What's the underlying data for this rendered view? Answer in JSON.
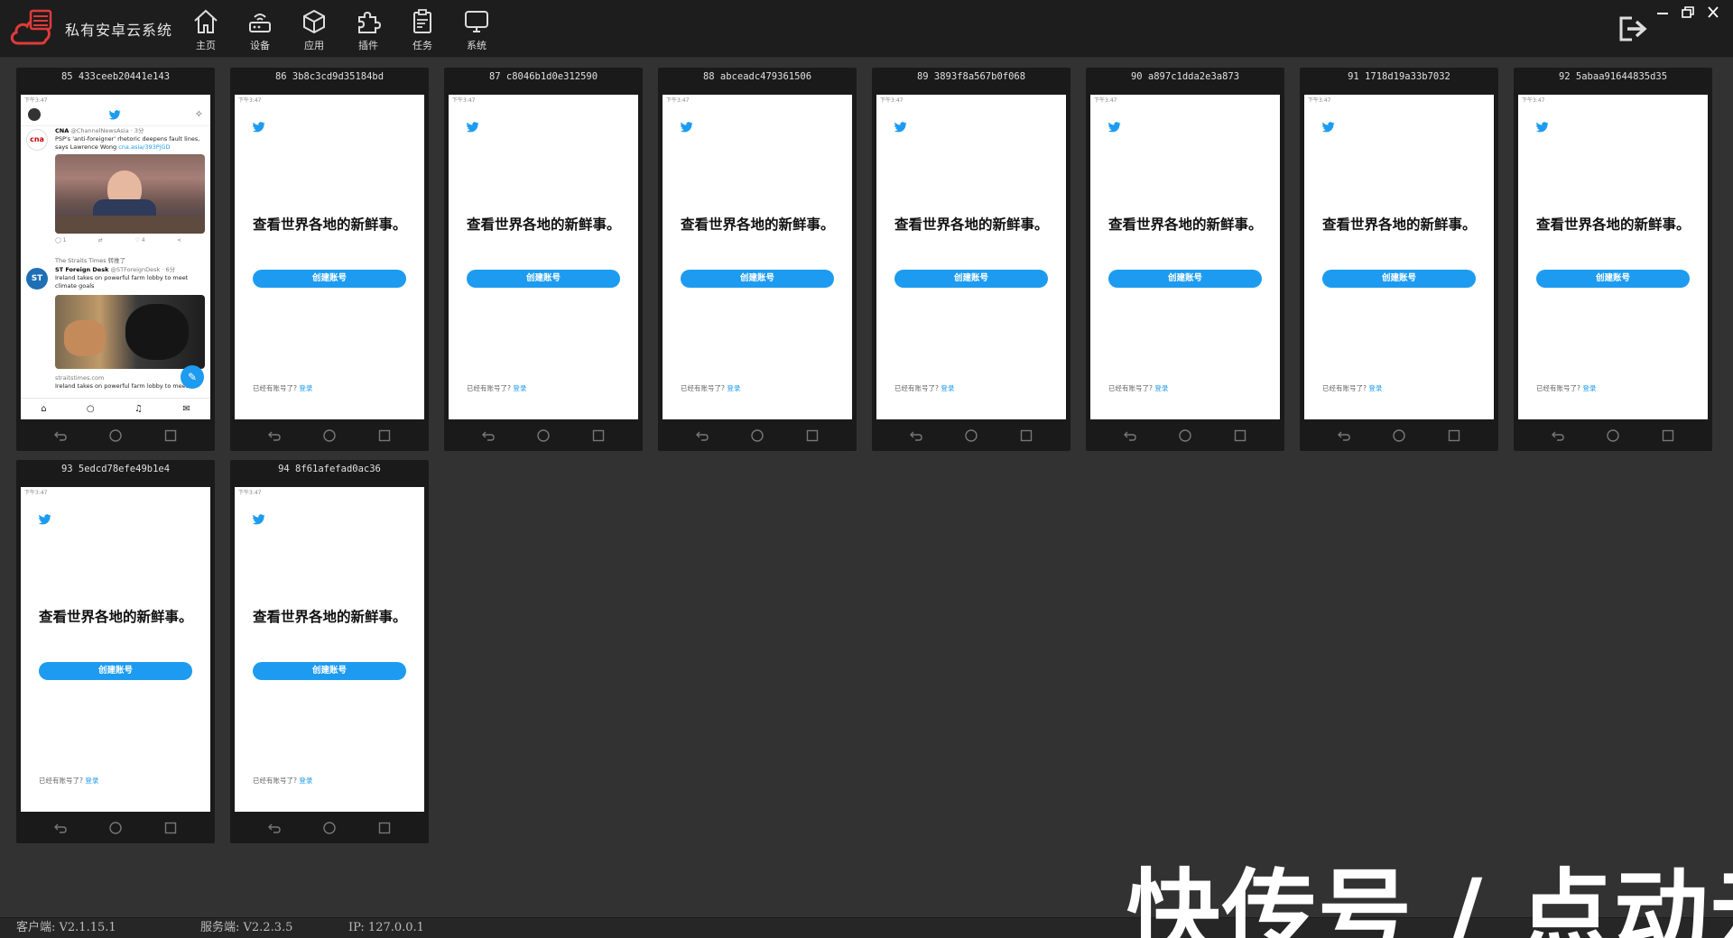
{
  "app": {
    "title": "私有安卓云系统"
  },
  "nav": [
    {
      "label": "主页",
      "icon": "home-icon"
    },
    {
      "label": "设备",
      "icon": "router-icon"
    },
    {
      "label": "应用",
      "icon": "cube-icon"
    },
    {
      "label": "插件",
      "icon": "puzzle-icon"
    },
    {
      "label": "任务",
      "icon": "clipboard-icon"
    },
    {
      "label": "系统",
      "icon": "monitor-icon"
    }
  ],
  "devices": [
    {
      "title": "85 433ceeb20441e143"
    },
    {
      "title": "86 3b8c3cd9d35184bd"
    },
    {
      "title": "87 c8046b1d0e312590"
    },
    {
      "title": "88 abceadc479361506"
    },
    {
      "title": "89 3893f8a567b0f068"
    },
    {
      "title": "90 a897c1dda2e3a873"
    },
    {
      "title": "91 1718d19a33b7032"
    },
    {
      "title": "92 5abaa91644835d35"
    },
    {
      "title": "93 5edcd78efe49b1e4"
    },
    {
      "title": "94 8f61afefad0ac36"
    }
  ],
  "signup": {
    "headline": "查看世界各地的新鲜事。",
    "create_label": "创建账号",
    "have_account": "已经有账号了?",
    "login_label": "登录",
    "time": "下午3:47"
  },
  "feed": {
    "tweet1": {
      "source": "CNA",
      "handle": "@ChannelNewsAsia · 3分",
      "text": "PSP's 'anti-foreigner' rhetoric deepens fault lines, says Lawrence Wong",
      "link": "cna.asia/393PjGD"
    },
    "tweet2": {
      "retweet": "The Straits Times 转推了",
      "source": "ST Foreign Desk",
      "handle": "@STForeignDesk · 6分",
      "text": "Ireland takes on powerful farm lobby to meet climate goals",
      "domain": "straitstimes.com",
      "teaser": "Ireland takes on powerful farm lobby to meet"
    },
    "counts": {
      "reply": "1",
      "like": "4"
    }
  },
  "statusbar": {
    "client": "客户端: V2.1.15.1",
    "server": "服务端: V2.2.3.5",
    "ip": "IP: 127.0.0.1"
  },
  "watermark": "快传号 / 点动云",
  "colors": {
    "background": "#323232",
    "topbar": "#1d1d1d",
    "twitter_blue": "#1d9bf0",
    "logo_red": "#e03a3a"
  }
}
